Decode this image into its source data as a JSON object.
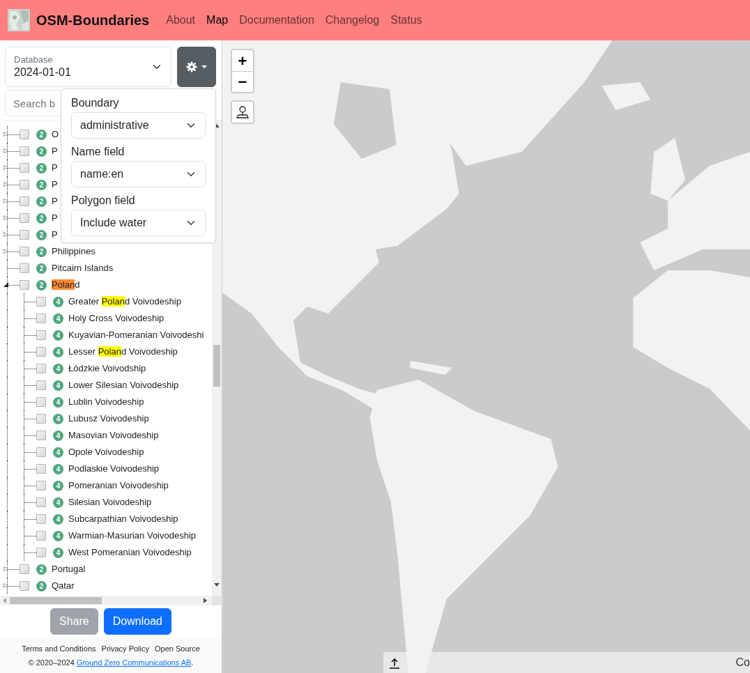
{
  "nav": {
    "brand": "OSM-Boundaries",
    "links": [
      {
        "label": "About",
        "selected": false
      },
      {
        "label": "Map",
        "selected": true
      },
      {
        "label": "Documentation",
        "selected": false
      },
      {
        "label": "Changelog",
        "selected": false
      },
      {
        "label": "Status",
        "selected": false
      }
    ]
  },
  "database": {
    "label": "Database",
    "value": "2024-01-01"
  },
  "search": {
    "placeholder": "Search b"
  },
  "settings_menu": {
    "open": true,
    "fields": [
      {
        "label": "Boundary",
        "value": "administrative"
      },
      {
        "label": "Name field",
        "value": "name:en"
      },
      {
        "label": "Polygon field",
        "value": "Include water"
      }
    ]
  },
  "tree": [
    {
      "label": "O",
      "level": "2",
      "checked": false,
      "expanded": false
    },
    {
      "label": "P",
      "level": "2",
      "checked": false,
      "expanded": false
    },
    {
      "label": "P",
      "level": "2",
      "checked": false,
      "expanded": false
    },
    {
      "label": "P",
      "level": "2",
      "checked": false,
      "expanded": false
    },
    {
      "label": "P",
      "level": "2",
      "checked": false,
      "expanded": false
    },
    {
      "label": "P",
      "level": "2",
      "checked": false,
      "expanded": false
    },
    {
      "label": "P",
      "level": "2",
      "checked": false,
      "expanded": false
    },
    {
      "label": "Philippines",
      "level": "2",
      "checked": false,
      "expanded": false
    },
    {
      "label": "Pitcairn Islands",
      "level": "2",
      "checked": false
    },
    {
      "label_parts": [
        {
          "text": "Polan",
          "highlighted": true,
          "active": true
        },
        {
          "text": "d",
          "highlighted": false
        }
      ],
      "level": "2",
      "checked": false,
      "expanded": true,
      "children": [
        {
          "label_parts": [
            {
              "text": "Greater ",
              "highlighted": false
            },
            {
              "text": "Polan",
              "highlighted": true,
              "active": false
            },
            {
              "text": "d Voivodeship",
              "highlighted": false
            }
          ],
          "level": "4",
          "checked": false
        },
        {
          "label": "Holy Cross Voivodeship",
          "level": "4",
          "checked": false
        },
        {
          "label": "Kuyavian-Pomeranian Voivodeshi",
          "level": "4",
          "checked": false
        },
        {
          "label_parts": [
            {
              "text": "Lesser ",
              "highlighted": false
            },
            {
              "text": "Polan",
              "highlighted": true,
              "active": false
            },
            {
              "text": "d Voivodeship",
              "highlighted": false
            }
          ],
          "level": "4",
          "checked": false
        },
        {
          "label": "Łódzkie Voivodship",
          "level": "4",
          "checked": false
        },
        {
          "label": "Lower Silesian Voivodeship",
          "level": "4",
          "checked": false
        },
        {
          "label": "Lublin Voivodeship",
          "level": "4",
          "checked": false
        },
        {
          "label": "Lubusz Voivodeship",
          "level": "4",
          "checked": false
        },
        {
          "label": "Masovian Voivodeship",
          "level": "4",
          "checked": false
        },
        {
          "label": "Opole Voivodeship",
          "level": "4",
          "checked": false
        },
        {
          "label": "Podlaskie Voivodeship",
          "level": "4",
          "checked": false
        },
        {
          "label": "Pomeranian Voivodeship",
          "level": "4",
          "checked": false
        },
        {
          "label": "Silesian Voivodeship",
          "level": "4",
          "checked": false
        },
        {
          "label": "Subcarpathian Voivodeship",
          "level": "4",
          "checked": false
        },
        {
          "label": "Warmian-Masurian Voivodeship",
          "level": "4",
          "checked": false
        },
        {
          "label": "West Pomeranian Voivodeship",
          "level": "4",
          "checked": false
        }
      ]
    },
    {
      "label": "Portugal",
      "level": "2",
      "checked": false,
      "expanded": false
    },
    {
      "label": "Qatar",
      "level": "2",
      "checked": false,
      "expanded": false
    }
  ],
  "buttons": [
    {
      "label": "Share",
      "kind": "secondary",
      "disabled": true
    },
    {
      "label": "Download",
      "kind": "primary",
      "disabled": false
    }
  ],
  "footer": {
    "links": [
      "Terms and Conditions",
      "Privacy Policy",
      "Open Source"
    ],
    "copyright": {
      "before": "© 2020–2024 ",
      "link": "Ground Zero Communications AB",
      "after": "."
    }
  },
  "map": {
    "zoom_in": "+",
    "zoom_out": "−",
    "attribution": "Co"
  }
}
